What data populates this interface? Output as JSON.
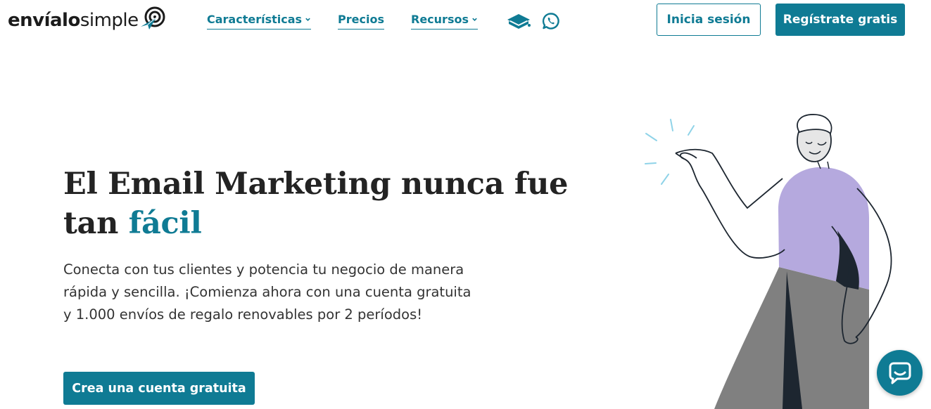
{
  "logo": {
    "text_bold": "envíalo",
    "text_regular": "simple"
  },
  "nav": {
    "items": [
      {
        "label": "Características",
        "has_dropdown": true
      },
      {
        "label": "Precios",
        "has_dropdown": false
      },
      {
        "label": "Recursos",
        "has_dropdown": true
      }
    ],
    "icons": [
      "book-icon",
      "whatsapp-icon"
    ]
  },
  "header": {
    "login_label": "Inicia sesión",
    "register_label": "Regístrate gratis"
  },
  "hero": {
    "title_regular": "El Email Marketing ",
    "title_bold": "nunca fue tan ",
    "title_accent": "fácil",
    "description": "Conecta con tus clientes y potencia tu negocio de manera rápida y sencilla. ¡Comienza ahora con una cuenta gratuita y 1.000 envíos de regalo renovables por 2 períodos!",
    "cta_label": "Crea una cuenta gratuita"
  },
  "colors": {
    "brand": "#0f7b94",
    "text": "#232323",
    "shirt": "#b5a9de",
    "pants": "#808080"
  }
}
